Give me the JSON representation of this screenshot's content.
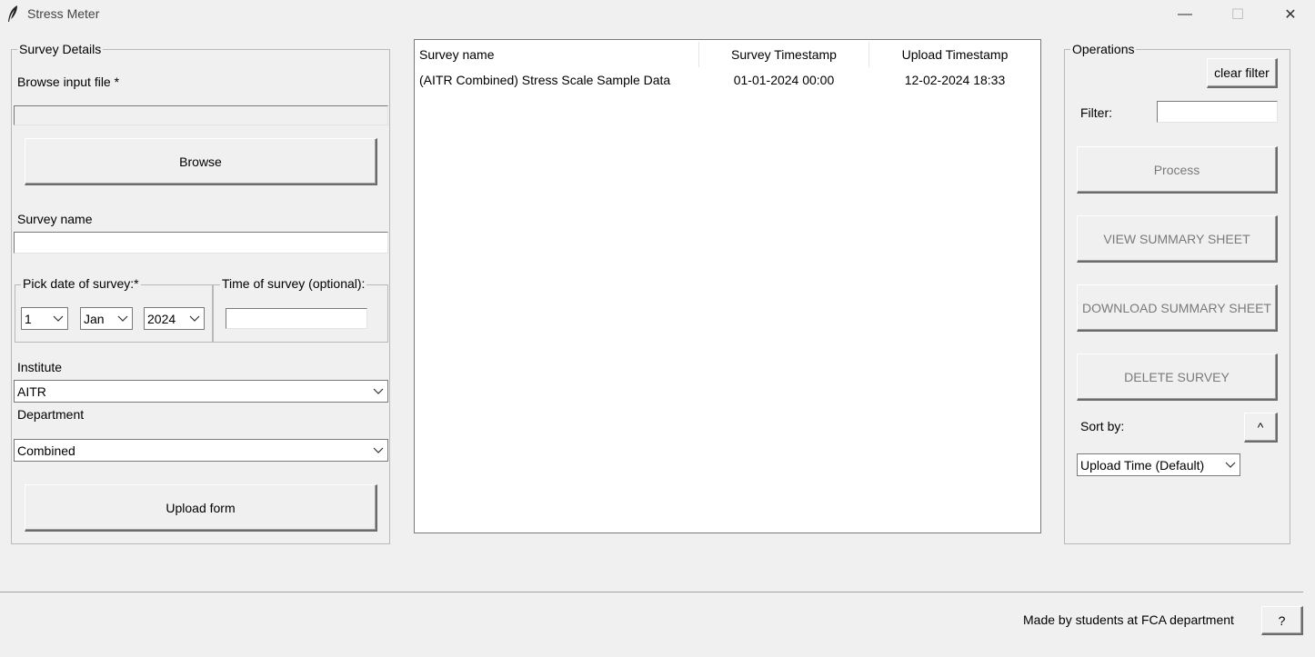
{
  "window": {
    "title": "Stress Meter",
    "minimize_glyph": "—",
    "maximize_glyph": "☐",
    "close_glyph": "✕"
  },
  "survey_details": {
    "group_label": "Survey Details",
    "browse_label": "Browse input file *",
    "file_path_value": "",
    "browse_button": "Browse",
    "survey_name_label": "Survey name",
    "survey_name_value": "",
    "date_label": "Pick date of survey:*",
    "time_label": "Time of survey (optional):",
    "day_value": "1",
    "month_value": "Jan",
    "year_value": "2024",
    "time_value": "",
    "institute_label": "Institute",
    "institute_value": "AITR",
    "department_label": "Department",
    "department_value": "Combined",
    "upload_button": "Upload form"
  },
  "survey_table": {
    "columns": [
      "Survey name",
      "Survey Timestamp",
      "Upload Timestamp"
    ],
    "rows": [
      {
        "name": "(AITR Combined) Stress Scale Sample Data",
        "survey_timestamp": "01-01-2024 00:00",
        "upload_timestamp": "12-02-2024 18:33"
      }
    ]
  },
  "operations": {
    "group_label": "Operations",
    "clear_filter_button": "clear filter",
    "filter_label": "Filter:",
    "filter_value": "",
    "process_button": "Process",
    "view_summary_button": "VIEW SUMMARY SHEET",
    "download_summary_button": "DOWNLOAD SUMMARY SHEET",
    "delete_survey_button": "DELETE SURVEY",
    "sort_label": "Sort by:",
    "sort_order_button": "^",
    "sort_value": "Upload Time (Default)"
  },
  "footer": {
    "credit_text": "Made by students at FCA department",
    "help_button": "?"
  }
}
